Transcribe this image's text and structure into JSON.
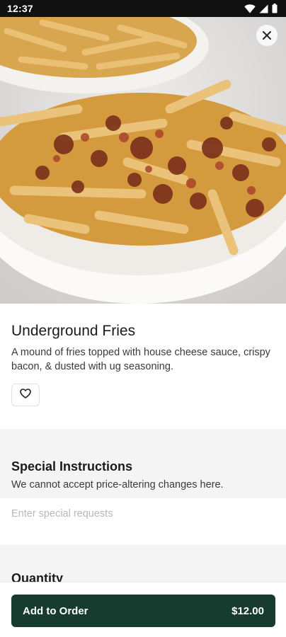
{
  "status_bar": {
    "time": "12:37"
  },
  "hero": {
    "image_alt_name": "fries-photo"
  },
  "item": {
    "name": "Underground Fries",
    "description": "A mound of fries topped with house cheese sauce, crispy bacon, & dusted with ug seasoning."
  },
  "special_instructions": {
    "title": "Special Instructions",
    "subtitle": "We cannot accept price-altering changes here.",
    "placeholder": "Enter special requests"
  },
  "quantity": {
    "title": "Quantity"
  },
  "bottom_bar": {
    "button_label": "Add to Order",
    "price": "$12.00"
  },
  "colors": {
    "primary_button": "#173b2e",
    "section_bg": "#f4f4f4"
  },
  "icons": [
    "wifi-icon",
    "signal-icon",
    "battery-icon",
    "close-icon",
    "heart-icon"
  ]
}
